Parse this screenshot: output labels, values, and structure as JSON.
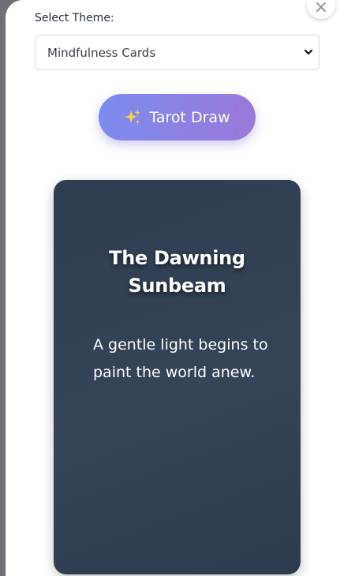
{
  "modal": {
    "close_label": "×"
  },
  "theme": {
    "label": "Select Theme:",
    "selected": "Mindfulness Cards"
  },
  "draw_button": {
    "icon": "sparkles-icon",
    "label": "Tarot Draw"
  },
  "card": {
    "title": "The Dawning Sunbeam",
    "text": "A gentle light begins to paint the world anew."
  },
  "colors": {
    "button_gradient_start": "#7b8cf0",
    "button_gradient_end": "#9a78d8",
    "card_background": "#324157",
    "backdrop": "#6f6f75"
  }
}
